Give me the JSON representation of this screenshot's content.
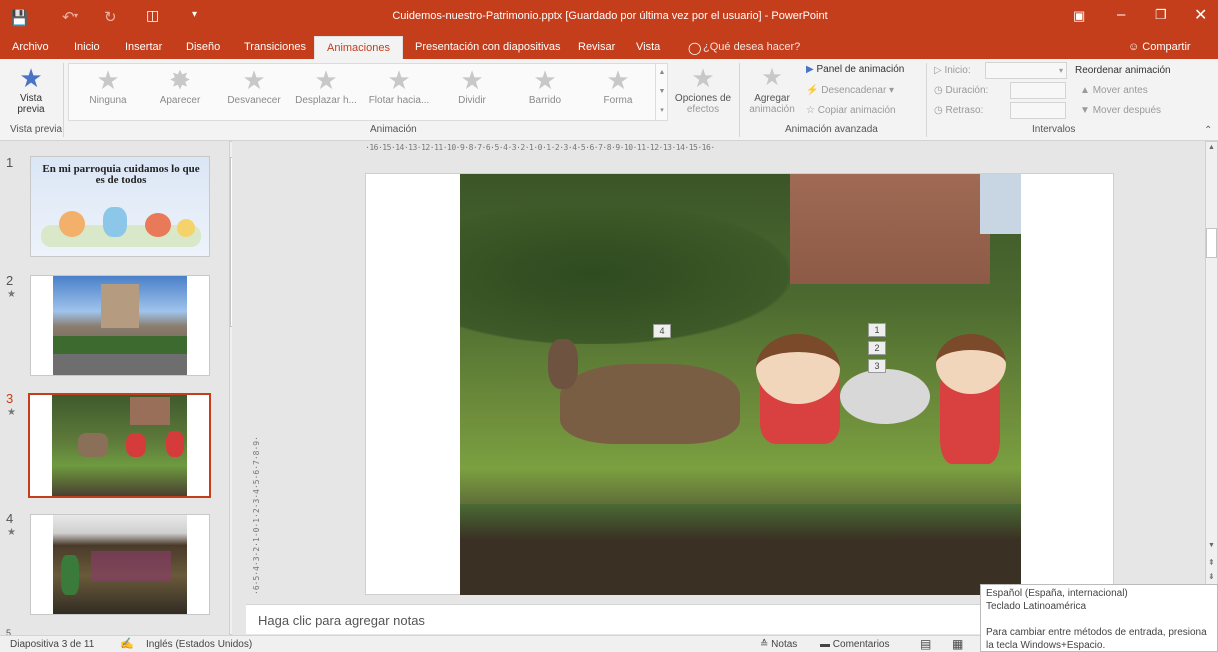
{
  "app": {
    "window_title": "Cuidemos-nuestro-Patrimonio.pptx [Guardado por última vez por el usuario] - PowerPoint",
    "share_label": "Compartir",
    "colors": {
      "accent": "#c43e1c",
      "ribbon_bg": "#f3f3f3",
      "selected_thumb_border": "#c43e1c"
    }
  },
  "tabs": [
    {
      "label": "Archivo"
    },
    {
      "label": "Inicio"
    },
    {
      "label": "Insertar"
    },
    {
      "label": "Diseño"
    },
    {
      "label": "Transiciones"
    },
    {
      "label": "Animaciones"
    },
    {
      "label": "Presentación con diapositivas"
    },
    {
      "label": "Revisar"
    },
    {
      "label": "Vista"
    },
    {
      "label": "¿Qué desea hacer?"
    }
  ],
  "ribbon": {
    "preview": {
      "label_line1": "Vista",
      "label_line2": "previa",
      "group_label": "Vista previa"
    },
    "gallery": [
      {
        "label": "Ninguna",
        "icon": "star-none-icon"
      },
      {
        "label": "Aparecer",
        "icon": "star-appear-icon"
      },
      {
        "label": "Desvanecer",
        "icon": "star-fade-icon"
      },
      {
        "label": "Desplazar h...",
        "icon": "star-fly-icon"
      },
      {
        "label": "Flotar hacia...",
        "icon": "star-float-icon"
      },
      {
        "label": "Dividir",
        "icon": "star-split-icon"
      },
      {
        "label": "Barrido",
        "icon": "star-wipe-icon"
      },
      {
        "label": "Forma",
        "icon": "star-shape-icon"
      }
    ],
    "effect_options": {
      "line1": "Opciones de",
      "line2": "efectos"
    },
    "animation_group_label": "Animación",
    "add_animation": {
      "line1": "Agregar",
      "line2": "animación"
    },
    "animation_pane": "Panel de animación",
    "trigger": "Desencadenar",
    "copy_animation": "Copiar animación",
    "advanced_group_label": "Animación avanzada",
    "start_label": "Inicio:",
    "start_value": "",
    "duration_label": "Duración:",
    "delay_label": "Retraso:",
    "reorder_label": "Reordenar animación",
    "move_earlier": "Mover antes",
    "move_later": "Mover después",
    "timing_group_label": "Intervalos"
  },
  "thumbnails": [
    {
      "number": "1",
      "title": "En mi parroquia cuidamos lo que es de todos",
      "has_animation": false
    },
    {
      "number": "2",
      "has_animation": true
    },
    {
      "number": "3",
      "has_animation": true,
      "selected": true
    },
    {
      "number": "4",
      "has_animation": true
    },
    {
      "number": "5",
      "has_animation": false
    }
  ],
  "star_glyph": "★",
  "slide": {
    "animation_tags": [
      "4",
      "1",
      "2",
      "3"
    ]
  },
  "ruler_text": "·16·15·14·13·12·11·10·9·8·7·6·5·4·3·2·1·0·1·2·3·4·5·6·7·8·9·10·11·12·13·14·15·16·",
  "notes_placeholder": "Haga clic para agregar notas",
  "status": {
    "slide_info": "Diapositiva 3 de 11",
    "language": "Inglés (Estados Unidos)",
    "notes": "Notas",
    "comments": "Comentarios"
  },
  "ime_tooltip": {
    "line1": "Español (España, internacional)",
    "line2": "Teclado Latinoamérica",
    "line3": "Para cambiar entre métodos de entrada, presiona",
    "line4": "la tecla Windows+Espacio."
  }
}
